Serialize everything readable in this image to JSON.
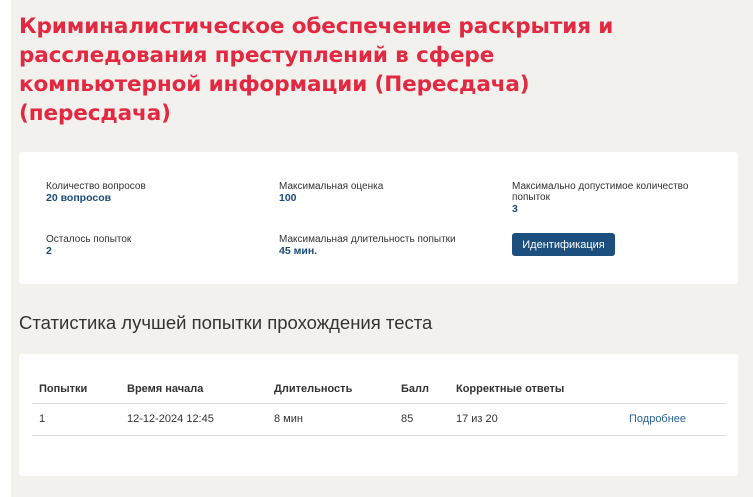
{
  "page": {
    "title": "Криминалистическое обеспечение раскрытия и расследования преступлений в сфере компьютерной информации (Пересдача) (пересдача)"
  },
  "info": {
    "questions_label": "Количество вопросов",
    "questions_value": "20 вопросов",
    "max_grade_label": "Максимальная оценка",
    "max_grade_value": "100",
    "max_attempts_label": "Максимально допустимое количество попыток",
    "max_attempts_value": "3",
    "remaining_label": "Осталось попыток",
    "remaining_value": "2",
    "duration_label": "Максимальная длительность попытки",
    "duration_value": "45 мин.",
    "identify_button": "Идентификация"
  },
  "stats": {
    "title": "Статистика лучшей попытки прохождения теста",
    "columns": [
      "Попытки",
      "Время начала",
      "Длительность",
      "Балл",
      "Корректные ответы",
      ""
    ],
    "rows": [
      {
        "attempt": "1",
        "start_time": "12-12-2024 12:45",
        "duration": "8 мин",
        "score": "85",
        "correct": "17 из 20",
        "link": "Подробнее"
      }
    ]
  }
}
